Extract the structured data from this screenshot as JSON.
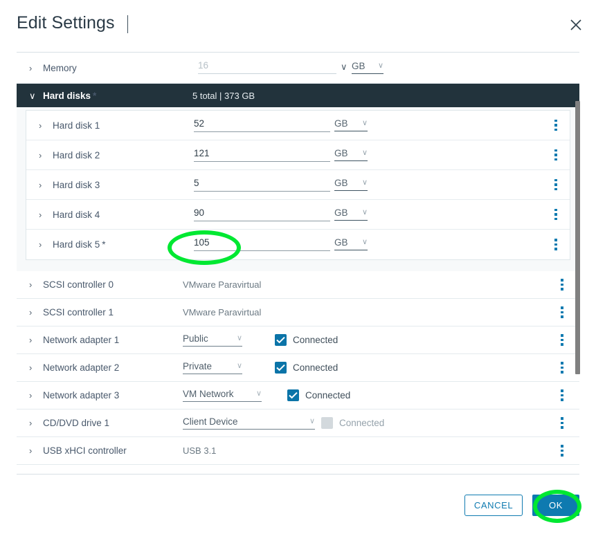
{
  "dialog": {
    "title": "Edit Settings",
    "close_icon": "close-icon"
  },
  "memory": {
    "label": "Memory",
    "value": "16",
    "placeholder": "16",
    "unit": "GB",
    "caret": "›",
    "stepper_icon": "∨"
  },
  "hard_disks_section": {
    "label": "Hard disks",
    "required_marker": "*",
    "summary": "5 total | 373 GB",
    "caret": "∨",
    "disks": [
      {
        "label": "Hard disk 1",
        "value": "52",
        "unit": "GB",
        "required_marker": ""
      },
      {
        "label": "Hard disk 2",
        "value": "121",
        "unit": "GB",
        "required_marker": ""
      },
      {
        "label": "Hard disk 3",
        "value": "5",
        "unit": "GB",
        "required_marker": ""
      },
      {
        "label": "Hard disk 4",
        "value": "90",
        "unit": "GB",
        "required_marker": ""
      },
      {
        "label": "Hard disk 5",
        "value": "105",
        "unit": "GB",
        "required_marker": "*"
      }
    ]
  },
  "devices": [
    {
      "label": "SCSI controller 0",
      "value": "VMware Paravirtual"
    },
    {
      "label": "SCSI controller 1",
      "value": "VMware Paravirtual"
    },
    {
      "label": "Network adapter 1",
      "select": "Public",
      "checkbox_label": "Connected",
      "checked": true
    },
    {
      "label": "Network adapter 2",
      "select": "Private",
      "checkbox_label": "Connected",
      "checked": true
    },
    {
      "label": "Network adapter 3",
      "select": "VM Network",
      "checkbox_label": "Connected",
      "checked": true
    },
    {
      "label": "CD/DVD drive 1",
      "select": "Client Device",
      "checkbox_label": "Connected",
      "checked": false
    },
    {
      "label": "USB xHCI controller",
      "value": "USB 3.1"
    }
  ],
  "footer": {
    "cancel_label": "CANCEL",
    "ok_label": "OK"
  },
  "annotations": {
    "disk5_highlight": "ellipse-around-hard-disk-5-value",
    "ok_highlight": "ellipse-around-ok-button",
    "color": "#00e832"
  },
  "icons": {
    "chevron_right": "›",
    "chevron_down": "∨",
    "dropdown_caret": "∨"
  }
}
